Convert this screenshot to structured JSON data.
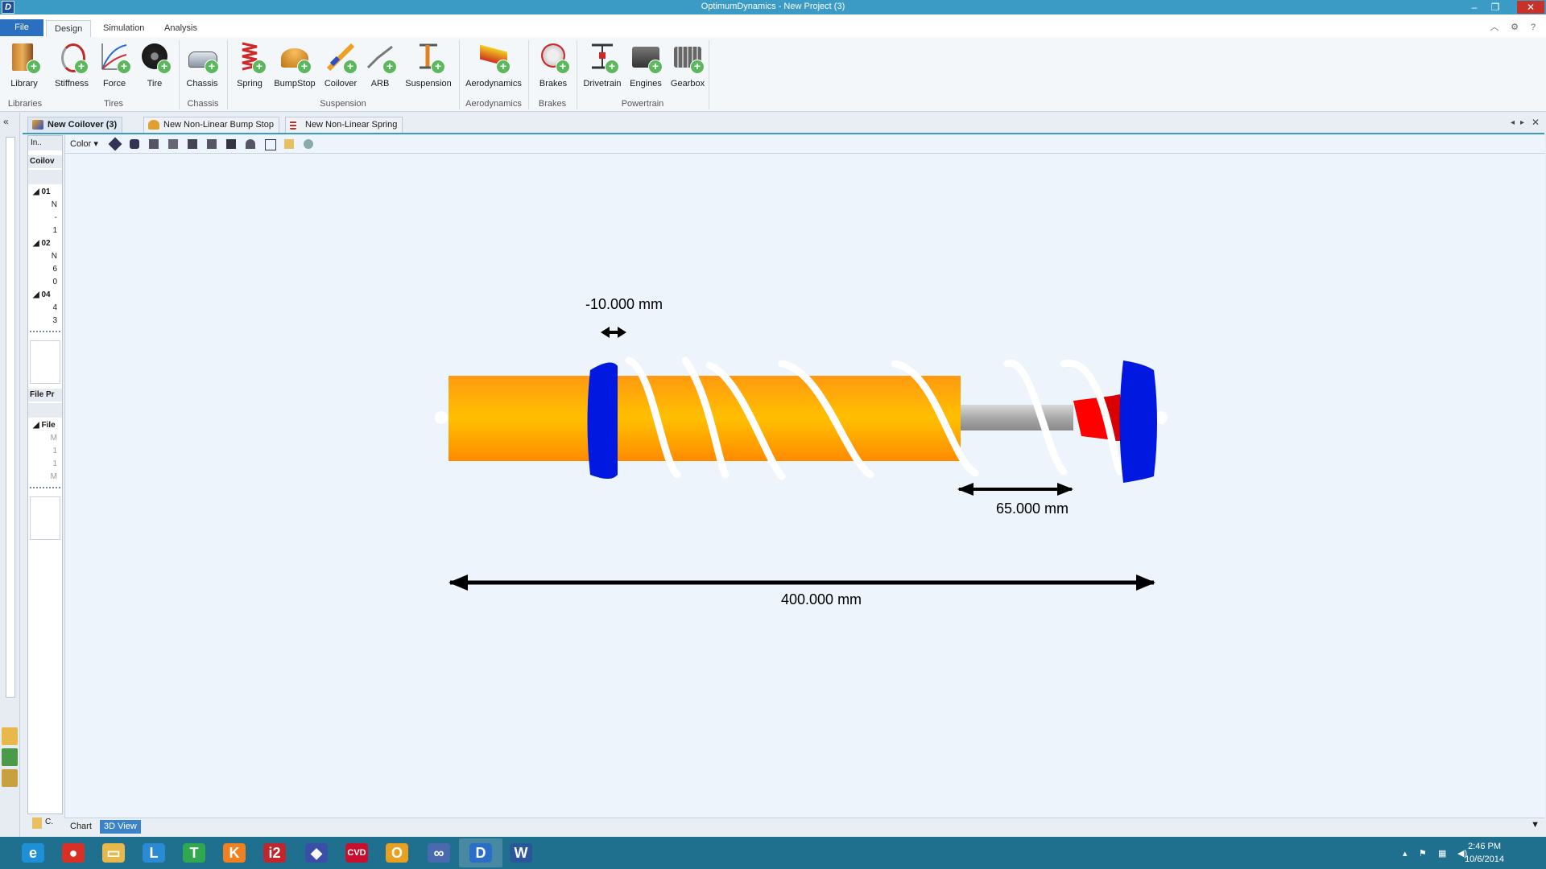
{
  "window": {
    "title": "OptimumDynamics - New Project (3)",
    "logo": "D"
  },
  "ribbon_tabs": [
    "File",
    "Design",
    "Simulation",
    "Analysis"
  ],
  "ribbon": {
    "buttons": [
      "Library",
      "Stiffness",
      "Force",
      "Tire",
      "Chassis",
      "Spring",
      "BumpStop",
      "Coilover",
      "ARB",
      "Suspension",
      "Aerodynamics",
      "Brakes",
      "Drivetrain",
      "Engines",
      "Gearbox"
    ],
    "groups": [
      "Libraries",
      "Tires",
      "Chassis",
      "Suspension",
      "Aerodynamics",
      "Brakes",
      "Powertrain"
    ]
  },
  "doc_tabs": [
    "New Coilover (3)",
    "New Non-Linear Bump Stop",
    "New Non-Linear Spring"
  ],
  "inspector": {
    "header": "In..",
    "section1": "Coilov",
    "rows1": [
      {
        "text": "01",
        "bold": true
      },
      {
        "text": "N"
      },
      {
        "text": "-"
      },
      {
        "text": "1"
      },
      {
        "text": "02",
        "bold": true
      },
      {
        "text": "N"
      },
      {
        "text": "6"
      },
      {
        "text": "0"
      },
      {
        "text": "04",
        "bold": true
      },
      {
        "text": "4"
      },
      {
        "text": "3"
      }
    ],
    "section2": "File Pr",
    "rows2": [
      {
        "text": "File",
        "bold": true
      },
      {
        "text": "M"
      },
      {
        "text": "1"
      },
      {
        "text": "1"
      },
      {
        "text": "M"
      }
    ]
  },
  "viewport": {
    "color_label": "Color",
    "dim_offset": "-10.000 mm",
    "dim_stroke": "65.000 mm",
    "dim_length": "400.000 mm"
  },
  "bottom_tabs": [
    "Chart",
    "3D View"
  ],
  "taskbar": {
    "apps": [
      {
        "icon": "internet-explorer-icon",
        "glyph": "e",
        "color": "#1e90d8"
      },
      {
        "icon": "chrome-icon",
        "glyph": "●",
        "color": "#d93025"
      },
      {
        "icon": "file-explorer-icon",
        "glyph": "▭",
        "color": "#e8b84a"
      },
      {
        "icon": "app-l-icon",
        "glyph": "L",
        "color": "#2a8ad4"
      },
      {
        "icon": "app-t-icon",
        "glyph": "T",
        "color": "#2fa84f"
      },
      {
        "icon": "app-k-icon",
        "glyph": "K",
        "color": "#f08020"
      },
      {
        "icon": "i2-pro-icon",
        "glyph": "i2",
        "color": "#c0262c"
      },
      {
        "icon": "cube-app-icon",
        "glyph": "◆",
        "color": "#3a4ea8"
      },
      {
        "icon": "cvd-icon",
        "glyph": "CVD",
        "color": "#c8102e"
      },
      {
        "icon": "outlook-icon",
        "glyph": "O",
        "color": "#e8a020"
      },
      {
        "icon": "glasses-app-icon",
        "glyph": "∞",
        "color": "#4a6ab0"
      },
      {
        "icon": "optimumdynamics-icon",
        "glyph": "D",
        "color": "#2a6ec8"
      },
      {
        "icon": "word-icon",
        "glyph": "W",
        "color": "#2b579a"
      }
    ],
    "time": "2:46 PM",
    "date": "10/6/2014"
  }
}
